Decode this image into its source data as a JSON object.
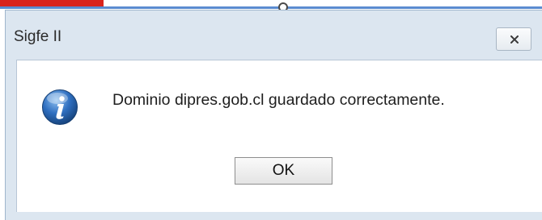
{
  "dialog": {
    "title": "Sigfe II",
    "close_label": "×",
    "message": "Dominio dipres.gob.cl guardado correctamente.",
    "ok_label": "OK",
    "icon": "info-icon"
  },
  "colors": {
    "accent_red": "#d9231d",
    "frame_blue": "#5a8bd0",
    "dialog_bg": "#dce6f0",
    "content_bg": "#ffffff"
  }
}
